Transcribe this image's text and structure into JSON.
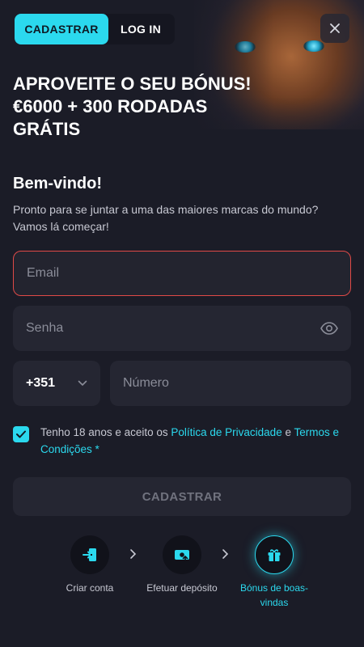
{
  "tabs": {
    "register": "CADASTRAR",
    "login": "LOG IN"
  },
  "promo": {
    "line1": "APROVEITE O SEU BÓNUS!",
    "line2": "€6000 + 300 RODADAS",
    "line3": "GRÁTIS"
  },
  "welcome": {
    "title": "Bem-vindo!",
    "subtitle": "Pronto para se juntar a uma das maiores marcas do mundo? Vamos lá começar!"
  },
  "form": {
    "email_placeholder": "Email",
    "password_placeholder": "Senha",
    "country_code": "+351",
    "number_placeholder": "Número"
  },
  "consent": {
    "checked": true,
    "text_before": "Tenho 18 anos e aceito os ",
    "privacy_link": "Política de Privacidade",
    "text_and": " e ",
    "terms_link": "Termos e Condições",
    "required_mark": " *"
  },
  "submit_label": "CADASTRAR",
  "steps": [
    {
      "label": "Criar conta",
      "icon": "sign-in-icon"
    },
    {
      "label": "Efetuar depósito",
      "icon": "deposit-icon"
    },
    {
      "label": "Bónus de boas-vindas",
      "icon": "gift-icon"
    }
  ],
  "colors": {
    "accent": "#2bd9ee",
    "background": "#1b1c27",
    "input": "#252632",
    "error_border": "#e04a47"
  }
}
